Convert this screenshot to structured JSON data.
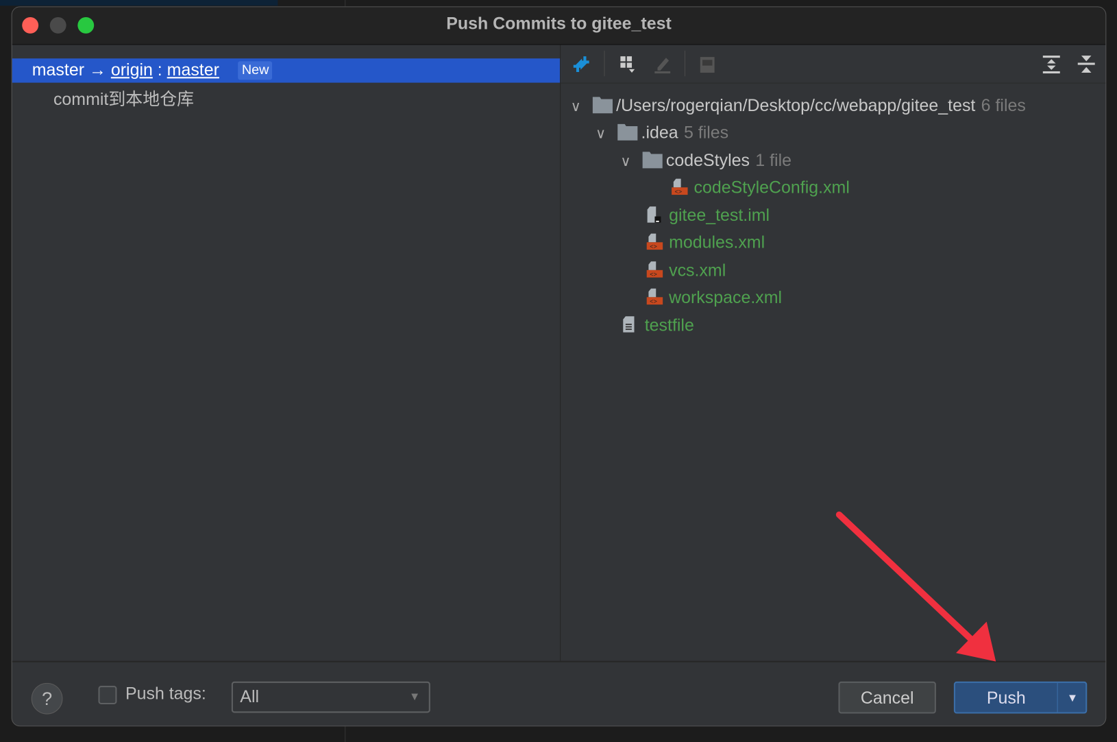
{
  "window": {
    "title": "Push Commits to gitee_test",
    "traffic_lights": {
      "close": "#ff5f57",
      "minimize": "#4a4a4a",
      "zoom": "#28c840"
    }
  },
  "left": {
    "branch": {
      "local": "master",
      "arrow": "→",
      "remote": "origin",
      "separator": ":",
      "remote_branch": "master",
      "badge": "New"
    },
    "commits": [
      {
        "message": "commit到本地仓库"
      }
    ]
  },
  "toolbar": {
    "icons": [
      "show-diff-icon",
      "group-by-icon",
      "edit-source-icon",
      "preview-icon",
      "expand-all-icon",
      "collapse-all-icon"
    ]
  },
  "tree": [
    {
      "name": "/Users/rogerqian/Desktop/cc/webapp/gitee_test",
      "count": "6 files",
      "type": "folder",
      "expanded": true
    },
    {
      "name": ".idea",
      "count": "5 files",
      "type": "folder",
      "expanded": true
    },
    {
      "name": "codeStyles",
      "count": "1 file",
      "type": "folder",
      "expanded": true
    },
    {
      "name": "codeStyleConfig.xml",
      "type": "xml"
    },
    {
      "name": "gitee_test.iml",
      "type": "iml"
    },
    {
      "name": "modules.xml",
      "type": "xml"
    },
    {
      "name": "vcs.xml",
      "type": "xml"
    },
    {
      "name": "workspace.xml",
      "type": "xml"
    },
    {
      "name": "testfile",
      "type": "text"
    }
  ],
  "footer": {
    "help": "?",
    "push_tags_label": "Push tags:",
    "push_tags_checked": false,
    "push_tags_value": "All",
    "cancel": "Cancel",
    "push": "Push"
  },
  "colors": {
    "selection": "#2557c9",
    "added_file": "#4fa14f",
    "primary_button": "#2b4f7d",
    "annotation_arrow": "#f0303f"
  }
}
